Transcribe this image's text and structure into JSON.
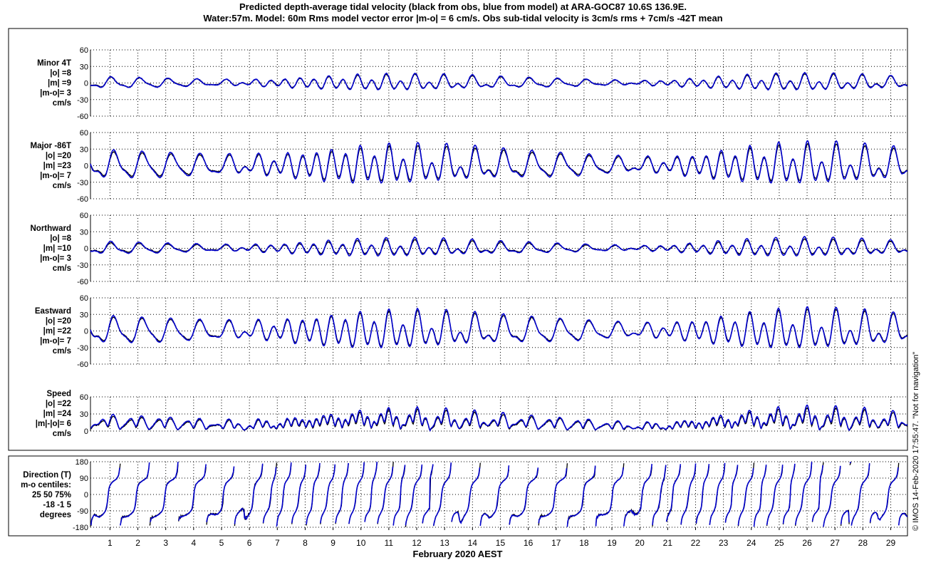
{
  "title": {
    "line1": "Predicted depth-average tidal velocity (black from obs, blue from model) at ARA-GOC87 10.6S 136.9E.",
    "line2": "Water:57m. Model: 60m  Rms model vector error |m-o| = 6 cm/s. Obs sub-tidal velocity is 3cm/s rms + 7cm/s -42T mean"
  },
  "xlabel": "February 2020 AEST",
  "credit": "© IMOS 14-Feb-2020 17:55:47.  \"Not for navigation\"",
  "colors": {
    "obs": "#000000",
    "model": "#0000cc",
    "grid": "#000000"
  },
  "panels": [
    {
      "key": "minor",
      "label": [
        "Minor 4T",
        "|o| =8",
        "|m| =9",
        "|m-o|= 3",
        "cm/s"
      ]
    },
    {
      "key": "major",
      "label": [
        "Major -86T",
        "|o| =20",
        "|m| =23",
        "|m-o|= 7",
        "cm/s"
      ]
    },
    {
      "key": "north",
      "label": [
        "Northward",
        "|o| =8",
        "|m| =10",
        "|m-o|= 3",
        "cm/s"
      ]
    },
    {
      "key": "east",
      "label": [
        "Eastward",
        "|o| =20",
        "|m| =22",
        "|m-o|= 7",
        "cm/s"
      ]
    },
    {
      "key": "speed",
      "label": [
        "Speed",
        "|o| =22",
        "|m| =24",
        "|m|-|o|= 6",
        "cm/s"
      ]
    },
    {
      "key": "dir",
      "label": [
        "Direction (T)",
        "m-o centiles:",
        "25  50  75%",
        "-18  -1   5",
        "degrees"
      ]
    }
  ],
  "chart_data": [
    {
      "type": "line",
      "name": "minor",
      "ylim": [
        -60,
        60
      ],
      "yticks": [
        "60",
        "30",
        "0",
        "-30",
        "-60"
      ],
      "amplitude": {
        "obs": 8,
        "model": 9
      }
    },
    {
      "type": "line",
      "name": "major",
      "ylim": [
        -60,
        60
      ],
      "yticks": [
        "60",
        "30",
        "0",
        "-30",
        "-60"
      ],
      "amplitude": {
        "obs": 20,
        "model": 23
      }
    },
    {
      "type": "line",
      "name": "north",
      "ylim": [
        -60,
        60
      ],
      "yticks": [
        "60",
        "30",
        "0",
        "-30",
        "-60"
      ],
      "amplitude": {
        "obs": 8,
        "model": 10
      }
    },
    {
      "type": "line",
      "name": "east",
      "ylim": [
        -60,
        60
      ],
      "yticks": [
        "60",
        "30",
        "0",
        "-30",
        "-60"
      ],
      "amplitude": {
        "obs": 20,
        "model": 22
      }
    },
    {
      "type": "line",
      "name": "speed",
      "ylim": [
        0,
        60
      ],
      "yticks": [
        "60",
        "30",
        "0"
      ],
      "amplitude": {
        "obs": 22,
        "model": 24
      }
    },
    {
      "type": "line",
      "name": "direction",
      "ylim": [
        -180,
        180
      ],
      "yticks": [
        "180",
        "90",
        "0",
        "-90",
        "-180"
      ],
      "centiles": {
        "p25": -18,
        "p50": -1,
        "p75": 5
      }
    }
  ],
  "x_axis": {
    "range_days": [
      0.3,
      29.6
    ],
    "tick_labels": [
      "1",
      "2",
      "3",
      "4",
      "5",
      "6",
      "7",
      "8",
      "9",
      "10",
      "11",
      "12",
      "13",
      "14",
      "15",
      "16",
      "17",
      "18",
      "19",
      "20",
      "21",
      "22",
      "23",
      "24",
      "25",
      "26",
      "27",
      "28",
      "29"
    ],
    "grid": true
  }
}
